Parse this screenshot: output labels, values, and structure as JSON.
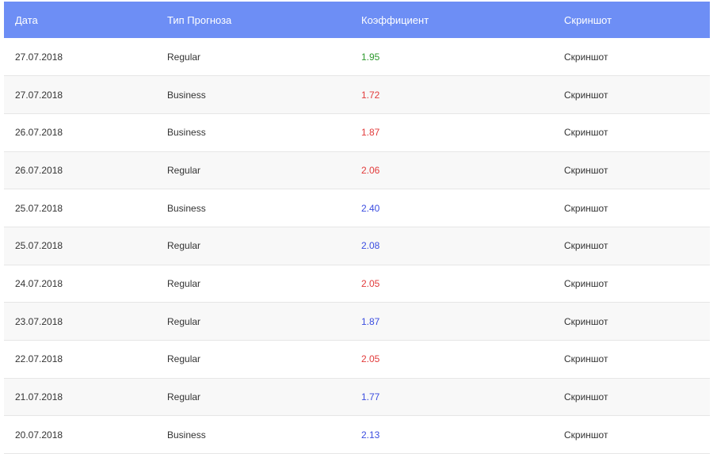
{
  "headers": {
    "date": "Дата",
    "type": "Тип Прогноза",
    "coef": "Коэффициент",
    "screenshot": "Скриншот"
  },
  "colors": {
    "header_bg": "#6d8ef5",
    "win": "#2e9a2e",
    "loss": "#e23b3b",
    "return": "#3b4de0"
  },
  "rows": [
    {
      "date": "27.07.2018",
      "type": "Regular",
      "coef": "1.95",
      "status": "win",
      "screenshot": "Скриншот"
    },
    {
      "date": "27.07.2018",
      "type": "Business",
      "coef": "1.72",
      "status": "loss",
      "screenshot": "Скриншот"
    },
    {
      "date": "26.07.2018",
      "type": "Business",
      "coef": "1.87",
      "status": "loss",
      "screenshot": "Скриншот"
    },
    {
      "date": "26.07.2018",
      "type": "Regular",
      "coef": "2.06",
      "status": "loss",
      "screenshot": "Скриншот"
    },
    {
      "date": "25.07.2018",
      "type": "Business",
      "coef": "2.40",
      "status": "return",
      "screenshot": "Скриншот"
    },
    {
      "date": "25.07.2018",
      "type": "Regular",
      "coef": "2.08",
      "status": "return",
      "screenshot": "Скриншот"
    },
    {
      "date": "24.07.2018",
      "type": "Regular",
      "coef": "2.05",
      "status": "loss",
      "screenshot": "Скриншот"
    },
    {
      "date": "23.07.2018",
      "type": "Regular",
      "coef": "1.87",
      "status": "return",
      "screenshot": "Скриншот"
    },
    {
      "date": "22.07.2018",
      "type": "Regular",
      "coef": "2.05",
      "status": "loss",
      "screenshot": "Скриншот"
    },
    {
      "date": "21.07.2018",
      "type": "Regular",
      "coef": "1.77",
      "status": "return",
      "screenshot": "Скриншот"
    },
    {
      "date": "20.07.2018",
      "type": "Business",
      "coef": "2.13",
      "status": "return",
      "screenshot": "Скриншот"
    }
  ]
}
